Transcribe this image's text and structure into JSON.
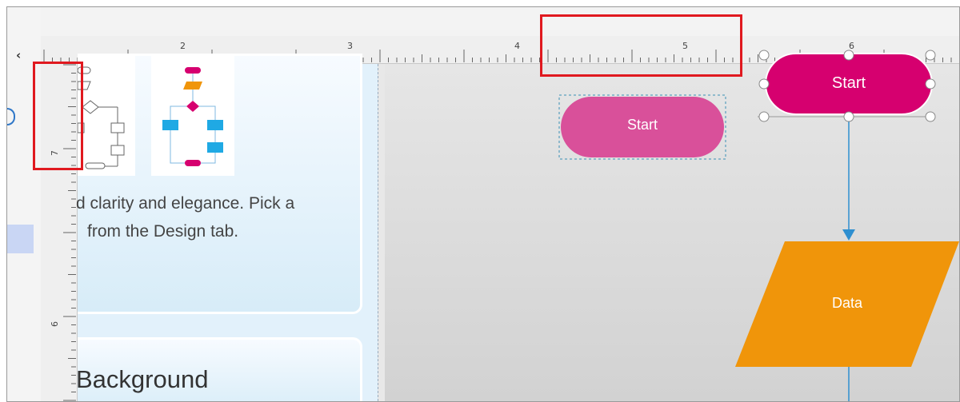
{
  "ruler": {
    "horizontal_labels": [
      "2",
      "3",
      "4",
      "5",
      "6"
    ],
    "vertical_labels": [
      "7",
      "6"
    ]
  },
  "template_card": {
    "description_line1": "d clarity and elegance. Pick a",
    "description_line2": "from the Design tab."
  },
  "background_card": {
    "title": "Background"
  },
  "canvas": {
    "start_preview_label": "Start",
    "start_selected_label": "Start",
    "data_label": "Data"
  },
  "colors": {
    "start_selected": "#d6006f",
    "start_preview": "#d9509a",
    "data": "#f0950a",
    "connector": "#2e8fd0",
    "highlight": "#e0191f",
    "accent_blue": "#1fa9e4"
  },
  "icons": {
    "collapse": "chevron-left-icon"
  }
}
